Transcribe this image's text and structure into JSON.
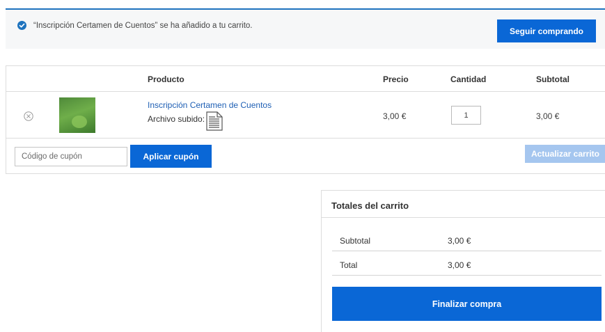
{
  "notice": {
    "message": "“Inscripción Certamen de Cuentos” se ha añadido a tu carrito.",
    "continue_label": "Seguir comprando",
    "icon": "check-circle-icon"
  },
  "cart": {
    "headers": {
      "product": "Producto",
      "price": "Precio",
      "quantity": "Cantidad",
      "subtotal": "Subtotal"
    },
    "items": [
      {
        "name": "Inscripción Certamen de Cuentos",
        "file_label": "Archivo subido:",
        "price": "3,00 €",
        "quantity": "1",
        "subtotal": "3,00 €"
      }
    ],
    "coupon_placeholder": "Código de cupón",
    "apply_coupon_label": "Aplicar cupón",
    "update_cart_label": "Actualizar carrito"
  },
  "totals": {
    "title": "Totales del carrito",
    "subtotal_label": "Subtotal",
    "subtotal_value": "3,00 €",
    "total_label": "Total",
    "total_value": "3,00 €",
    "checkout_label": "Finalizar compra"
  },
  "colors": {
    "accent": "#0a67d6",
    "accent_disabled": "#a5c6ef",
    "notice_border": "#1e73be",
    "link": "#1e5fb4"
  }
}
